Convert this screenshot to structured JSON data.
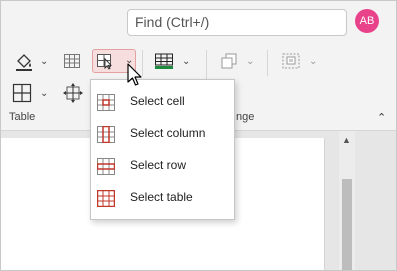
{
  "search": {
    "placeholder": "Find (Ctrl+/)"
  },
  "user": {
    "initials": "AB",
    "avatar_color": "#e8438a"
  },
  "ribbon": {
    "groups": [
      {
        "label": "Table"
      },
      {
        "label": "nge"
      }
    ]
  },
  "select_menu": {
    "items": [
      {
        "label": "Select cell",
        "icon": "select-cell-icon"
      },
      {
        "label": "Select column",
        "icon": "select-column-icon"
      },
      {
        "label": "Select row",
        "icon": "select-row-icon"
      },
      {
        "label": "Select table",
        "icon": "select-table-icon"
      }
    ]
  },
  "colors": {
    "accent_red": "#c0392b",
    "table_green": "#1e8a3e",
    "selected_button_bg": "#f7dede"
  }
}
